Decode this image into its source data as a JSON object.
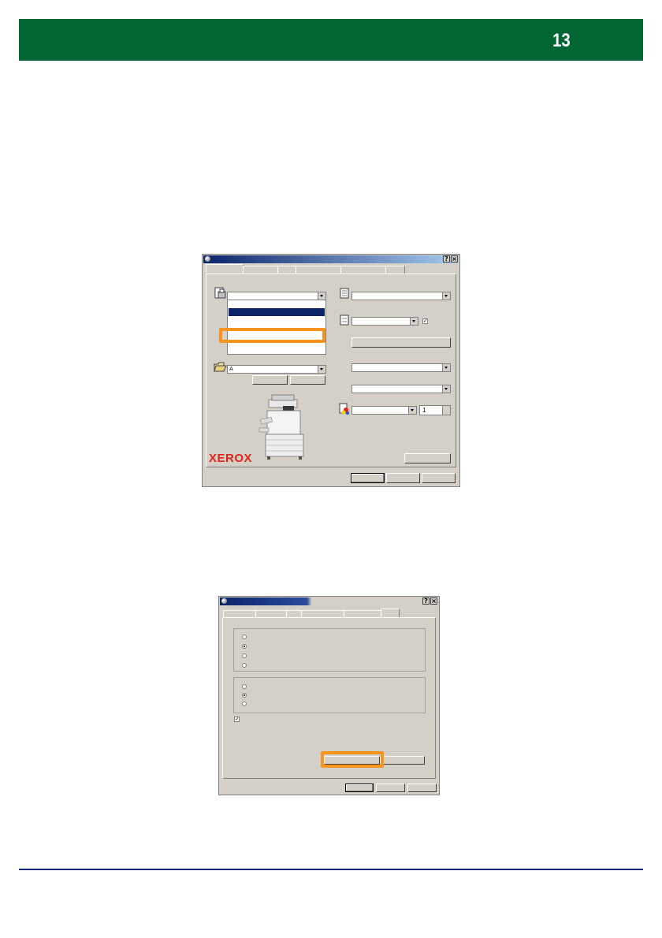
{
  "header": {
    "page_number": "13",
    "color": "#006633"
  },
  "dialog1": {
    "help_glyph": "?",
    "close_glyph": "×",
    "spinner_value": "1",
    "text_box_glyph": "A",
    "checkbox_glyph": "✓",
    "logo_text": "XEROX"
  },
  "dialog2": {
    "help_glyph": "?",
    "close_glyph": "×",
    "checkbox_glyph": "✓",
    "radio_group_1": [
      false,
      true,
      false,
      false
    ],
    "radio_group_2": [
      false,
      true,
      false
    ]
  },
  "colors": {
    "highlight": "#f7941d",
    "selection": "#0a246a",
    "footer_rule": "#1a237e",
    "brand_red": "#e2231a"
  }
}
